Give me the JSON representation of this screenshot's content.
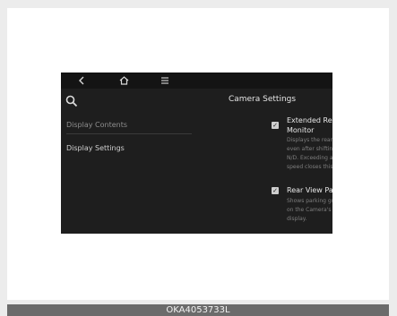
{
  "nav": {
    "back_icon": "chevron-left-icon",
    "home_icon": "home-icon",
    "menu_icon": "menu-icon"
  },
  "left_panel": {
    "search_icon": "search-icon",
    "items": [
      {
        "label": "Display Contents"
      },
      {
        "label": "Display Settings"
      }
    ]
  },
  "right_panel": {
    "title": "Camera Settings",
    "options": [
      {
        "checked": true,
        "title_line1": "Extended Rear View",
        "title_line2": "Monitor",
        "desc_lines": [
          "Displays the rear camera view",
          "even after shifting from R to",
          "N/D. Exceeding a certain",
          "speed closes this rear view."
        ]
      },
      {
        "checked": true,
        "title_line1": "Rear View Parking Lines",
        "desc_lines": [
          "Shows parking guidance lines",
          "on the Camera's Rear View",
          "display."
        ]
      }
    ]
  },
  "caption": "OKA4053733L",
  "colors": {
    "screen_bg": "#1e1e1e",
    "nav_bg": "#141414",
    "caption_bg": "#6b6b6b",
    "page_bg": "#ececec"
  }
}
